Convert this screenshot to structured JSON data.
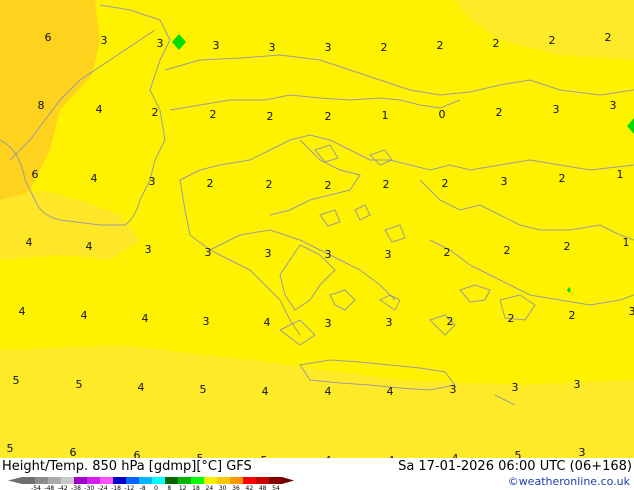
{
  "header": {
    "title": "Height/Temp. 850 hPa [gdmp][°C] GFS",
    "datetime": "Sa 17-01-2026 06:00 UTC (06+168)",
    "credit": "©weatheronline.co.uk"
  },
  "colors": {
    "background_field": "#fff200",
    "warm_patch": "#ffd21e",
    "mid_patch": "#ffe628",
    "coastline": "#9c9c9c",
    "contour_marker": "#00dd00"
  },
  "legend": {
    "ticks": [
      "-54",
      "-48",
      "-42",
      "-38",
      "-30",
      "-24",
      "-18",
      "-12",
      "-8",
      "0",
      "8",
      "12",
      "18",
      "24",
      "30",
      "36",
      "42",
      "48",
      "54"
    ],
    "swatches": [
      "#6e6e6e",
      "#8c8c8c",
      "#aaaaaa",
      "#c8c8c8",
      "#a000c8",
      "#d21ef0",
      "#ff50ff",
      "#0000c8",
      "#0064ff",
      "#00b4ff",
      "#00ffff",
      "#006400",
      "#00b400",
      "#00ff00",
      "#f0f000",
      "#ffc800",
      "#ff9600",
      "#ff0000",
      "#c80000",
      "#820000"
    ]
  },
  "map_values": [
    {
      "t": "6"
    },
    {
      "t": "3"
    },
    {
      "t": "3"
    },
    {
      "t": "3"
    },
    {
      "t": "3"
    },
    {
      "t": "3"
    },
    {
      "t": "2"
    },
    {
      "t": "2"
    },
    {
      "t": "2"
    },
    {
      "t": "2"
    },
    {
      "t": "2"
    },
    {
      "t": "8"
    },
    {
      "t": "4"
    },
    {
      "t": "2"
    },
    {
      "t": "2"
    },
    {
      "t": "2"
    },
    {
      "t": "2"
    },
    {
      "t": "1"
    },
    {
      "t": "0"
    },
    {
      "t": "2"
    },
    {
      "t": "3"
    },
    {
      "t": "3"
    },
    {
      "t": "6"
    },
    {
      "t": "4"
    },
    {
      "t": "3"
    },
    {
      "t": "2"
    },
    {
      "t": "2"
    },
    {
      "t": "2"
    },
    {
      "t": "2"
    },
    {
      "t": "2"
    },
    {
      "t": "3"
    },
    {
      "t": "2"
    },
    {
      "t": "1"
    },
    {
      "t": "4"
    },
    {
      "t": "4"
    },
    {
      "t": "3"
    },
    {
      "t": "3"
    },
    {
      "t": "3"
    },
    {
      "t": "3"
    },
    {
      "t": "3"
    },
    {
      "t": "2"
    },
    {
      "t": "2"
    },
    {
      "t": "2"
    },
    {
      "t": "1"
    },
    {
      "t": "4"
    },
    {
      "t": "4"
    },
    {
      "t": "4"
    },
    {
      "t": "3"
    },
    {
      "t": "4"
    },
    {
      "t": "3"
    },
    {
      "t": "3"
    },
    {
      "t": "2"
    },
    {
      "t": "2"
    },
    {
      "t": "2"
    },
    {
      "t": "3"
    },
    {
      "t": "5"
    },
    {
      "t": "5"
    },
    {
      "t": "4"
    },
    {
      "t": "5"
    },
    {
      "t": "4"
    },
    {
      "t": "4"
    },
    {
      "t": "4"
    },
    {
      "t": "3"
    },
    {
      "t": "3"
    },
    {
      "t": "3"
    },
    {
      "t": "5"
    },
    {
      "t": "6"
    },
    {
      "t": "6"
    },
    {
      "t": "5"
    },
    {
      "t": "5"
    },
    {
      "t": "4"
    },
    {
      "t": "4"
    },
    {
      "t": "4"
    },
    {
      "t": "5"
    },
    {
      "t": "3"
    }
  ]
}
